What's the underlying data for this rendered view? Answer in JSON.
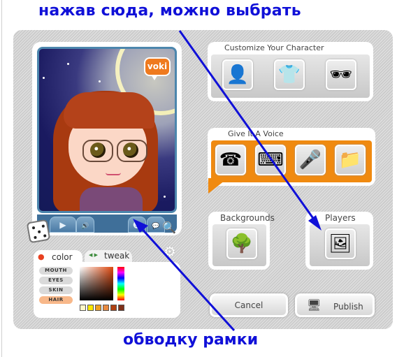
{
  "annotations": {
    "top": "нажав сюда, можно выбрать",
    "bottom": "обводку рамки"
  },
  "player": {
    "logo": "voki",
    "controls": [
      {
        "name": "play",
        "icon": "play-icon",
        "glyph": "▶"
      },
      {
        "name": "volume",
        "icon": "speaker-icon",
        "glyph": "🔊"
      },
      {
        "name": "character",
        "icon": "character-icon",
        "glyph": "☻"
      },
      {
        "name": "chat",
        "icon": "speech-bubble-icon",
        "glyph": "💬"
      }
    ],
    "zoom_glyph": "🔍",
    "gear_glyph": "⚙"
  },
  "color_panel": {
    "tabs": [
      {
        "label": "color",
        "active": true
      },
      {
        "label": "tweak",
        "active": false
      }
    ],
    "tweak_arrows": "◀ ▶",
    "parts": [
      {
        "label": "MOUTH",
        "active": false
      },
      {
        "label": "EYES",
        "active": false
      },
      {
        "label": "SKIN",
        "active": false
      },
      {
        "label": "HAIR",
        "active": true
      }
    ],
    "swatches": [
      "#fff8c8",
      "#f8e800",
      "#f0a020",
      "#e88a40",
      "#b04010",
      "#803018"
    ]
  },
  "customize": {
    "title": "Customize Your Character",
    "buttons": [
      {
        "name": "head",
        "glyph": "👤"
      },
      {
        "name": "clothing",
        "glyph": "👕"
      },
      {
        "name": "accessories",
        "glyph": "🕶"
      }
    ]
  },
  "voice": {
    "title": "Give It A Voice",
    "buttons": [
      {
        "name": "phone",
        "glyph": "☎"
      },
      {
        "name": "text-to-speech",
        "glyph": "⌨"
      },
      {
        "name": "microphone",
        "glyph": "🎤"
      },
      {
        "name": "upload",
        "glyph": "📁"
      }
    ]
  },
  "backgrounds": {
    "title": "Backgrounds",
    "glyph": "🌳"
  },
  "players": {
    "title": "Players",
    "glyph": "🖼"
  },
  "actions": {
    "cancel": "Cancel",
    "publish": "Publish",
    "publish_glyph": "🖥"
  },
  "colors": {
    "annotation": "#1010d8",
    "voice_accent": "#f08a10",
    "hair_active": "#f8b88a",
    "player_blue": "#3f6f99"
  }
}
